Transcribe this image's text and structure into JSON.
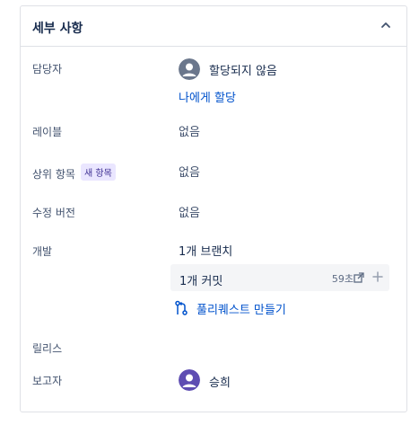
{
  "panel": {
    "title": "세부 사항"
  },
  "assignee": {
    "label": "담당자",
    "value": "할당되지 않음",
    "assign_to_me": "나에게 할당"
  },
  "labels": {
    "label": "레이블",
    "value": "없음"
  },
  "parent": {
    "label": "상위 항목",
    "badge": "새 항목",
    "value": "없음"
  },
  "fix_version": {
    "label": "수정 버전",
    "value": "없음"
  },
  "development": {
    "label": "개발",
    "branch": "1개 브랜치",
    "commit": "1개 커밋",
    "commit_time": "59초",
    "create_pr": "풀리퀘스트 만들기"
  },
  "release": {
    "label": "릴리스"
  },
  "reporter": {
    "label": "보고자",
    "value": "승희"
  },
  "colors": {
    "link": "#0052cc",
    "badge_bg": "#eae6ff",
    "badge_text": "#403294",
    "reporter_avatar": "#5e4db2",
    "unassigned_avatar": "#6b778c"
  },
  "icons": {
    "collapse": "chevron-up-icon",
    "external": "external-link-icon",
    "add": "plus-icon",
    "pull_request": "pull-request-icon"
  }
}
